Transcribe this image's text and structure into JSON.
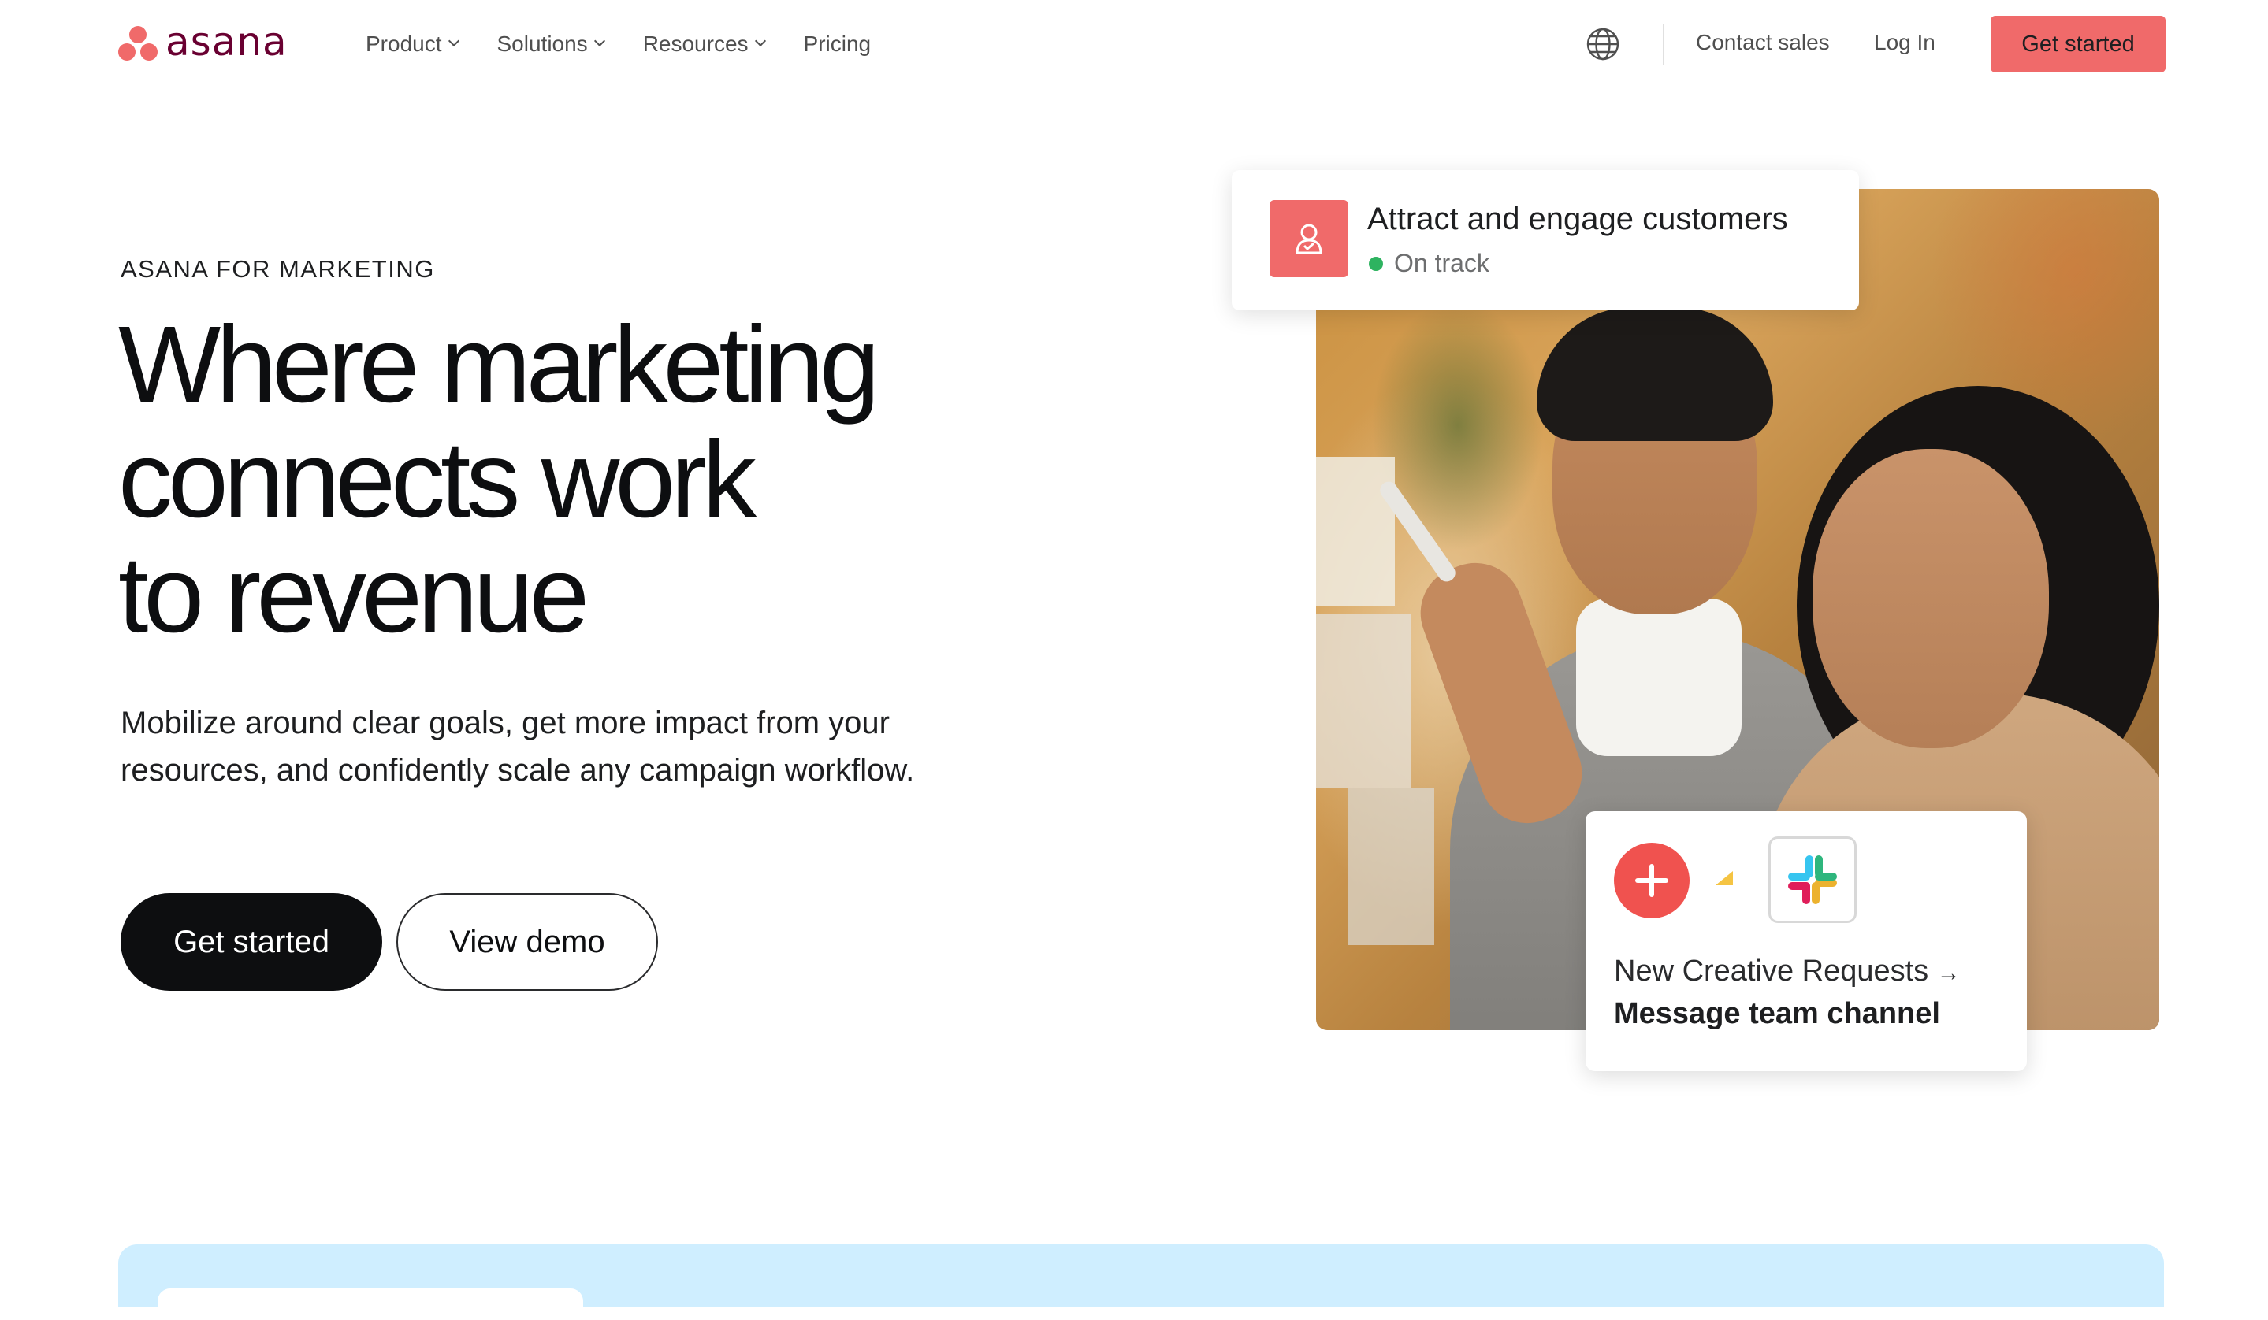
{
  "nav": {
    "logo_text": "asana",
    "links": [
      {
        "label": "Product",
        "has_dropdown": true
      },
      {
        "label": "Solutions",
        "has_dropdown": true
      },
      {
        "label": "Resources",
        "has_dropdown": true
      },
      {
        "label": "Pricing",
        "has_dropdown": false
      }
    ],
    "globe_icon": "globe-icon",
    "contact_sales": "Contact sales",
    "log_in": "Log In",
    "cta": "Get started"
  },
  "hero": {
    "eyebrow": "ASANA FOR MARKETING",
    "headline": [
      "Where marketing",
      "connects work",
      "to revenue"
    ],
    "subcopy": "Mobilize around clear goals, get more impact from your resources, and confidently scale any campaign workflow.",
    "primary_button": "Get started",
    "secondary_button": "View demo"
  },
  "goal_card": {
    "icon": "person-goal-icon",
    "title": "Attract and engage customers",
    "status": "On track",
    "status_color": "#2eb360"
  },
  "integration_card": {
    "left_icon": "plus-icon",
    "right_icon": "slack-icon",
    "trigger_text": "New Creative Requests",
    "arrow": "→",
    "action_text": "Message team channel"
  },
  "colors": {
    "brand_coral": "#f06a6a",
    "brand_plum": "#690031",
    "dark": "#0d0e10",
    "band_blue": "#cfeeff"
  }
}
